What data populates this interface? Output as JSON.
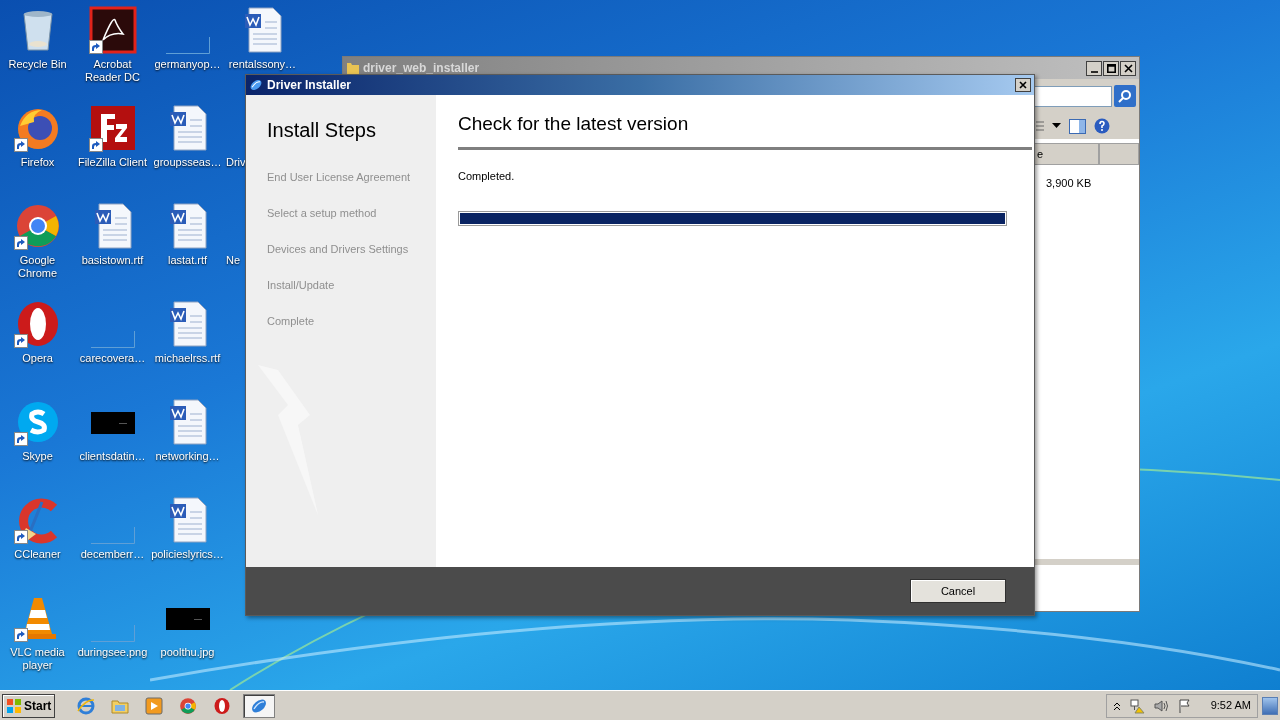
{
  "desktop_columns": [
    {
      "icons": [
        {
          "label": "Recycle Bin",
          "kind": "recycle",
          "shortcut": false
        },
        {
          "label": "Firefox",
          "kind": "firefox",
          "shortcut": true
        },
        {
          "label": "Google Chrome",
          "kind": "chrome",
          "shortcut": true
        },
        {
          "label": "Opera",
          "kind": "opera",
          "shortcut": true
        },
        {
          "label": "Skype",
          "kind": "skype",
          "shortcut": true
        },
        {
          "label": "CCleaner",
          "kind": "ccleaner",
          "shortcut": true
        },
        {
          "label": "VLC media player",
          "kind": "vlc",
          "shortcut": true
        }
      ]
    },
    {
      "icons": [
        {
          "label": "Acrobat Reader DC",
          "kind": "acrobat",
          "shortcut": true
        },
        {
          "label": "FileZilla Client",
          "kind": "filezilla",
          "shortcut": true
        },
        {
          "label": "basistown.rtf",
          "kind": "word",
          "shortcut": false
        },
        {
          "label": "carecovera…",
          "kind": "blank",
          "shortcut": false
        },
        {
          "label": "clientsdatin…",
          "kind": "dark",
          "shortcut": false
        },
        {
          "label": "decemberr…",
          "kind": "blank",
          "shortcut": false
        },
        {
          "label": "duringsee.png",
          "kind": "blank",
          "shortcut": false
        }
      ]
    },
    {
      "icons": [
        {
          "label": "germanyop…",
          "kind": "blank",
          "shortcut": false
        },
        {
          "label": "groupsseas…",
          "kind": "word",
          "shortcut": false
        },
        {
          "label": "lastat.rtf",
          "kind": "word",
          "shortcut": false
        },
        {
          "label": "michaelrss.rtf",
          "kind": "word",
          "shortcut": false
        },
        {
          "label": "networking…",
          "kind": "word",
          "shortcut": false
        },
        {
          "label": "policieslyrics…",
          "kind": "word",
          "shortcut": false
        },
        {
          "label": "poolthu.jpg",
          "kind": "dark",
          "shortcut": false
        }
      ]
    },
    {
      "icons": [
        {
          "label": "rentalssony…",
          "kind": "word",
          "shortcut": false
        },
        {
          "label": "Driv",
          "kind": "covered",
          "shortcut": false
        },
        {
          "label": "Ne",
          "kind": "covered",
          "shortcut": false
        }
      ]
    }
  ],
  "explorer_window": {
    "title": "driver_web_installer",
    "column_1": "e",
    "size_cell": "3,900 KB"
  },
  "installer_window": {
    "title": "Driver Installer",
    "sidebar_title": "Install Steps",
    "steps": [
      "End User License Agreement",
      "Select a setup method",
      "Devices and Drivers Settings",
      "Install/Update",
      "Complete"
    ],
    "heading": "Check for the latest version",
    "status": "Completed.",
    "progress": {
      "level": 1
    },
    "cancel_button": "Cancel"
  },
  "taskbar": {
    "start": "Start",
    "apps": [
      {
        "kind": "ie",
        "selected": false
      },
      {
        "kind": "folder",
        "selected": false
      },
      {
        "kind": "media",
        "selected": false
      },
      {
        "kind": "chrome",
        "selected": false
      },
      {
        "kind": "opera",
        "selected": false
      },
      {
        "kind": "installer",
        "selected": true
      }
    ],
    "time": "9:52 AM"
  }
}
